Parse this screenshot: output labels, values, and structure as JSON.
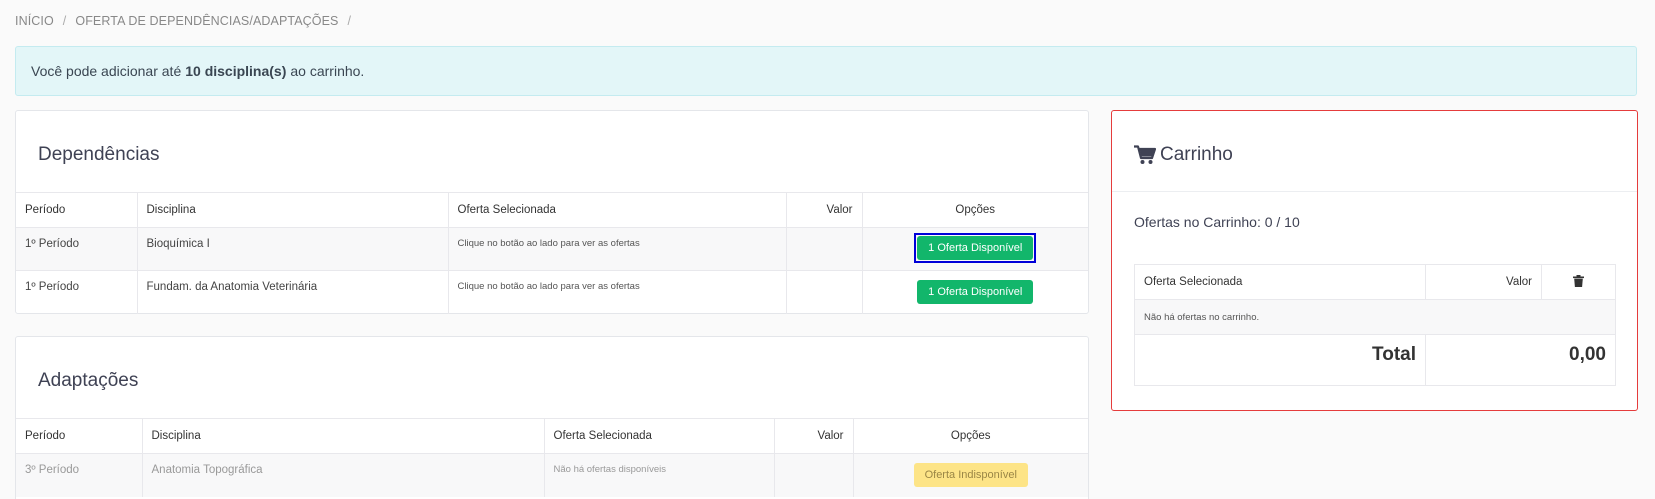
{
  "breadcrumb": {
    "home": "INÍCIO",
    "current": "OFERTA DE DEPENDÊNCIAS/ADAPTAÇÕES",
    "sep": "/"
  },
  "alert": {
    "prefix": "Você pode adicionar até",
    "highlight": "10 disciplina(s)",
    "suffix": "ao carrinho."
  },
  "dependencias": {
    "title": "Dependências",
    "headers": [
      "Período",
      "Disciplina",
      "Oferta Selecionada",
      "Valor",
      "Opções"
    ],
    "rows": [
      {
        "periodo": "1º Período",
        "disciplina": "Bioquímica I",
        "oferta": "Clique no botão ao lado para ver as ofertas",
        "valor": "",
        "button": "1 Oferta Disponível"
      },
      {
        "periodo": "1º Período",
        "disciplina": "Fundam. da Anatomia Veterinária",
        "oferta": "Clique no botão ao lado para ver as ofertas",
        "valor": "",
        "button": "1 Oferta Disponível"
      }
    ]
  },
  "adaptacoes": {
    "title": "Adaptações",
    "headers": [
      "Período",
      "Disciplina",
      "Oferta Selecionada",
      "Valor",
      "Opções"
    ],
    "rows": [
      {
        "periodo": "3º Período",
        "disciplina": "Anatomia Topográfica",
        "oferta": "Não há ofertas disponíveis",
        "valor": "",
        "button": "Oferta Indisponível"
      }
    ]
  },
  "cart": {
    "title": "Carrinho",
    "count_text": "Ofertas no Carrinho: 0 / 10",
    "headers": [
      "Oferta Selecionada",
      "Valor"
    ],
    "empty_text": "Não há ofertas no carrinho.",
    "total_label": "Total",
    "total_value": "0,00"
  },
  "colors": {
    "accent_green": "#12b66b",
    "cart_border": "#e53c3c",
    "unavailable": "#fde487"
  }
}
